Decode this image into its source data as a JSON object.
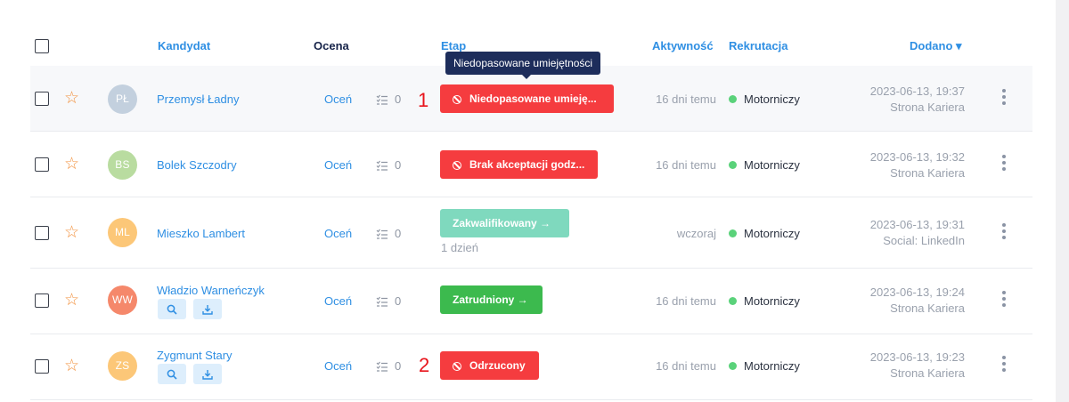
{
  "header": {
    "candidate": "Kandydat",
    "rating": "Ocena",
    "stage": "Etap",
    "activity": "Aktywność",
    "recruitment": "Rekrutacja",
    "added": "Dodano ▾"
  },
  "tooltip": "Niedopasowane umiejętności",
  "rows": [
    {
      "initials": "PŁ",
      "avatar_color": "#c3d0de",
      "name": "Przemysł Ładny",
      "rate": "Oceń",
      "tasks": "0",
      "stage": "Niedopasowane umieję...",
      "stage_color": "#f53c3f",
      "stage_sub": "",
      "activity": "16 dni temu",
      "recruitment": "Motorniczy",
      "added_date": "2023-06-13, 19:37",
      "added_source": "Strona Kariera"
    },
    {
      "initials": "BS",
      "avatar_color": "#b9dca0",
      "name": "Bolek Szczodry",
      "rate": "Oceń",
      "tasks": "0",
      "stage": "Brak akceptacji godz...",
      "stage_color": "#f53c3f",
      "stage_sub": "",
      "activity": "16 dni temu",
      "recruitment": "Motorniczy",
      "added_date": "2023-06-13, 19:32",
      "added_source": "Strona Kariera"
    },
    {
      "initials": "ML",
      "avatar_color": "#fcc778",
      "name": "Mieszko Lambert",
      "rate": "Oceń",
      "tasks": "0",
      "stage": "Zakwalifikowany →",
      "stage_color": "#7fd9be",
      "stage_sub": "1 dzień",
      "activity": "wczoraj",
      "recruitment": "Motorniczy",
      "added_date": "2023-06-13, 19:31",
      "added_source": "Social: LinkedIn"
    },
    {
      "initials": "WW",
      "avatar_color": "#f5886b",
      "name": "Władzio Warneńczyk",
      "rate": "Oceń",
      "tasks": "0",
      "stage": "Zatrudniony →",
      "stage_color": "#3cba4e",
      "stage_sub": "",
      "activity": "16 dni temu",
      "recruitment": "Motorniczy",
      "added_date": "2023-06-13, 19:24",
      "added_source": "Strona Kariera"
    },
    {
      "initials": "ZS",
      "avatar_color": "#fcc778",
      "name": "Zygmunt Stary",
      "rate": "Oceń",
      "tasks": "0",
      "stage": "Odrzucony",
      "stage_color": "#f53c3f",
      "stage_sub": "",
      "activity": "16 dni temu",
      "recruitment": "Motorniczy",
      "added_date": "2023-06-13, 19:23",
      "added_source": "Strona Kariera"
    }
  ],
  "annotations": [
    "1",
    "2"
  ]
}
